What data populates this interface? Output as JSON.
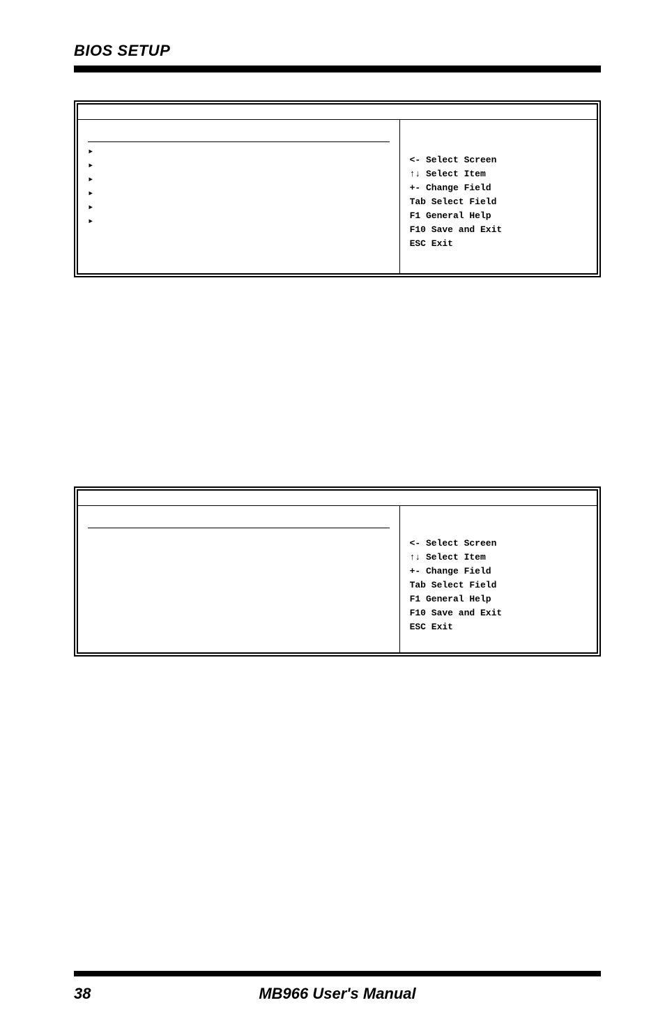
{
  "header": {
    "title": "BIOS SETUP"
  },
  "box1": {
    "arrows": [
      "▸",
      "▸",
      "▸",
      "▸",
      "▸",
      "▸"
    ],
    "help": [
      "<-  Select Screen",
      "↑↓ Select Item",
      "+-  Change Field",
      "Tab Select Field",
      "F1  General Help",
      "F10 Save and Exit",
      "ESC Exit"
    ]
  },
  "box2": {
    "help": [
      "<-  Select Screen",
      "↑↓ Select Item",
      "+-  Change Field",
      "Tab Select Field",
      "F1  General Help",
      "F10 Save and Exit",
      "ESC Exit"
    ]
  },
  "footer": {
    "page": "38",
    "manual": "MB966 User's Manual"
  }
}
